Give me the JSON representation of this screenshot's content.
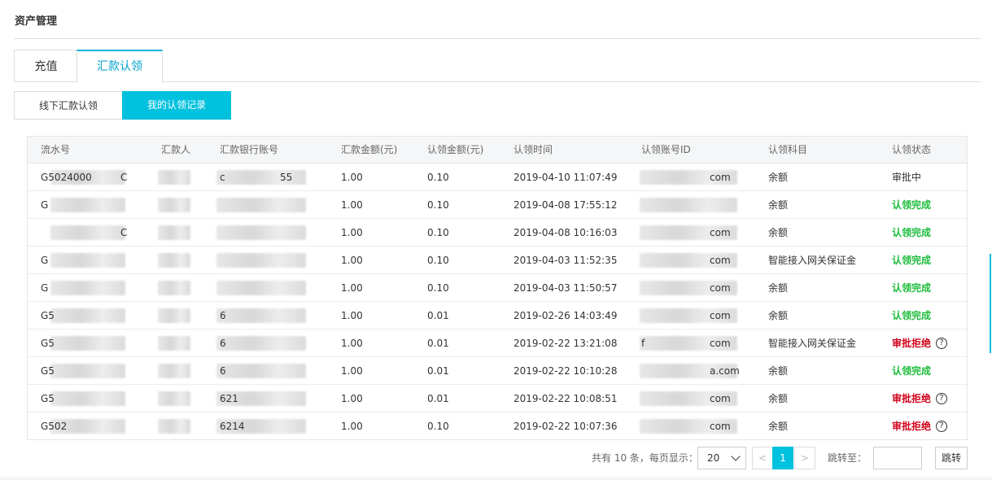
{
  "page": {
    "title": "资产管理"
  },
  "tabs": [
    "充值",
    "汇款认领"
  ],
  "sub_tabs": [
    "线下汇款认领",
    "我的认领记录"
  ],
  "table": {
    "headers": [
      "流水号",
      "汇款人",
      "汇款银行账号",
      "汇款金额(元)",
      "认领金额(元)",
      "认领时间",
      "认领账号ID",
      "认领科目",
      "认领状态"
    ],
    "rows": [
      {
        "serial": "G5024000",
        "serial_end": "C",
        "remitter": "",
        "bank": "c",
        "bank_end": "55",
        "amount": "1.00",
        "claim": "0.10",
        "time": "2019-04-10 11:07:49",
        "account": "",
        "account_end": "com",
        "subject": "余额",
        "status": "审批中",
        "status_type": "pending"
      },
      {
        "serial": "G",
        "serial_end": "",
        "remitter": "",
        "bank": "",
        "bank_end": "",
        "amount": "1.00",
        "claim": "0.10",
        "time": "2019-04-08 17:55:12",
        "account": "",
        "account_end": "",
        "subject": "余额",
        "status": "认领完成",
        "status_type": "done"
      },
      {
        "serial": "",
        "serial_end": "C",
        "remitter": "",
        "bank": "",
        "bank_end": "",
        "amount": "1.00",
        "claim": "0.10",
        "time": "2019-04-08 10:16:03",
        "account": "",
        "account_end": "com",
        "subject": "余额",
        "status": "认领完成",
        "status_type": "done"
      },
      {
        "serial": "G",
        "serial_end": "",
        "remitter": "",
        "bank": "",
        "bank_end": "",
        "amount": "1.00",
        "claim": "0.10",
        "time": "2019-04-03 11:52:35",
        "account": "",
        "account_end": "com",
        "subject": "智能接入网关保证金",
        "status": "认领完成",
        "status_type": "done"
      },
      {
        "serial": "G",
        "serial_end": "",
        "remitter": "",
        "bank": "",
        "bank_end": "",
        "amount": "1.00",
        "claim": "0.10",
        "time": "2019-04-03 11:50:57",
        "account": "",
        "account_end": "com",
        "subject": "余额",
        "status": "认领完成",
        "status_type": "done"
      },
      {
        "serial": "G5",
        "serial_end": "",
        "remitter": "",
        "bank": "6",
        "bank_end": "",
        "amount": "1.00",
        "claim": "0.01",
        "time": "2019-02-26 14:03:49",
        "account": "",
        "account_end": "com",
        "subject": "余额",
        "status": "认领完成",
        "status_type": "done"
      },
      {
        "serial": "G5",
        "serial_end": "",
        "remitter": "",
        "bank": "6",
        "bank_end": "",
        "amount": "1.00",
        "claim": "0.01",
        "time": "2019-02-22 13:21:08",
        "account": "f",
        "account_end": "com",
        "subject": "智能接入网关保证金",
        "status": "审批拒绝",
        "status_type": "reject"
      },
      {
        "serial": "G5",
        "serial_end": "",
        "remitter": "",
        "bank": "6",
        "bank_end": "",
        "amount": "1.00",
        "claim": "0.01",
        "time": "2019-02-22 10:10:28",
        "account": "",
        "account_end": "a.com",
        "subject": "余额",
        "status": "认领完成",
        "status_type": "done"
      },
      {
        "serial": "G5",
        "serial_end": "",
        "remitter": "",
        "bank": "621",
        "bank_end": "",
        "amount": "1.00",
        "claim": "0.01",
        "time": "2019-02-22 10:08:51",
        "account": "",
        "account_end": "com",
        "subject": "余额",
        "status": "审批拒绝",
        "status_type": "reject"
      },
      {
        "serial": "G502",
        "serial_end": "",
        "remitter": "",
        "bank": "6214",
        "bank_end": "",
        "amount": "1.00",
        "claim": "0.10",
        "time": "2019-02-22 10:07:36",
        "account": "",
        "account_end": "com",
        "subject": "余额",
        "status": "审批拒绝",
        "status_type": "reject"
      }
    ]
  },
  "pagination": {
    "total_text": "共有 10 条，每页显示：",
    "page_size": "20",
    "prev": "<",
    "current": "1",
    "next": ">",
    "jump_label": "跳转至：",
    "jump_button": "跳转"
  },
  "colors": {
    "accent": "#00c1de",
    "done": "#1dbd3c",
    "reject": "#d0021b"
  },
  "icons": {
    "help": "question-circle-icon"
  }
}
